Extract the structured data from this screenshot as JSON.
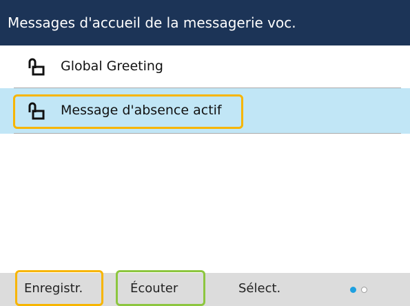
{
  "header": {
    "title": "Messages d'accueil de la messagerie voc."
  },
  "list": {
    "items": [
      {
        "label": "Global Greeting",
        "icon": "lock-open-icon"
      },
      {
        "label": "Message d'absence actif",
        "icon": "lock-open-icon",
        "selected": true
      }
    ]
  },
  "softkeys": {
    "record": "Enregistr.",
    "listen": "Écouter",
    "select": "Sélect."
  },
  "pager": {
    "current_page": 1,
    "total_pages": 2
  },
  "colors": {
    "header_bg": "#1c3457",
    "selected_row_bg": "#c1e6f6",
    "highlight_orange": "#f7b500",
    "highlight_green": "#8cc63f",
    "softkey_bar_bg": "#dcdcdc",
    "pager_active": "#1ea0e0"
  }
}
